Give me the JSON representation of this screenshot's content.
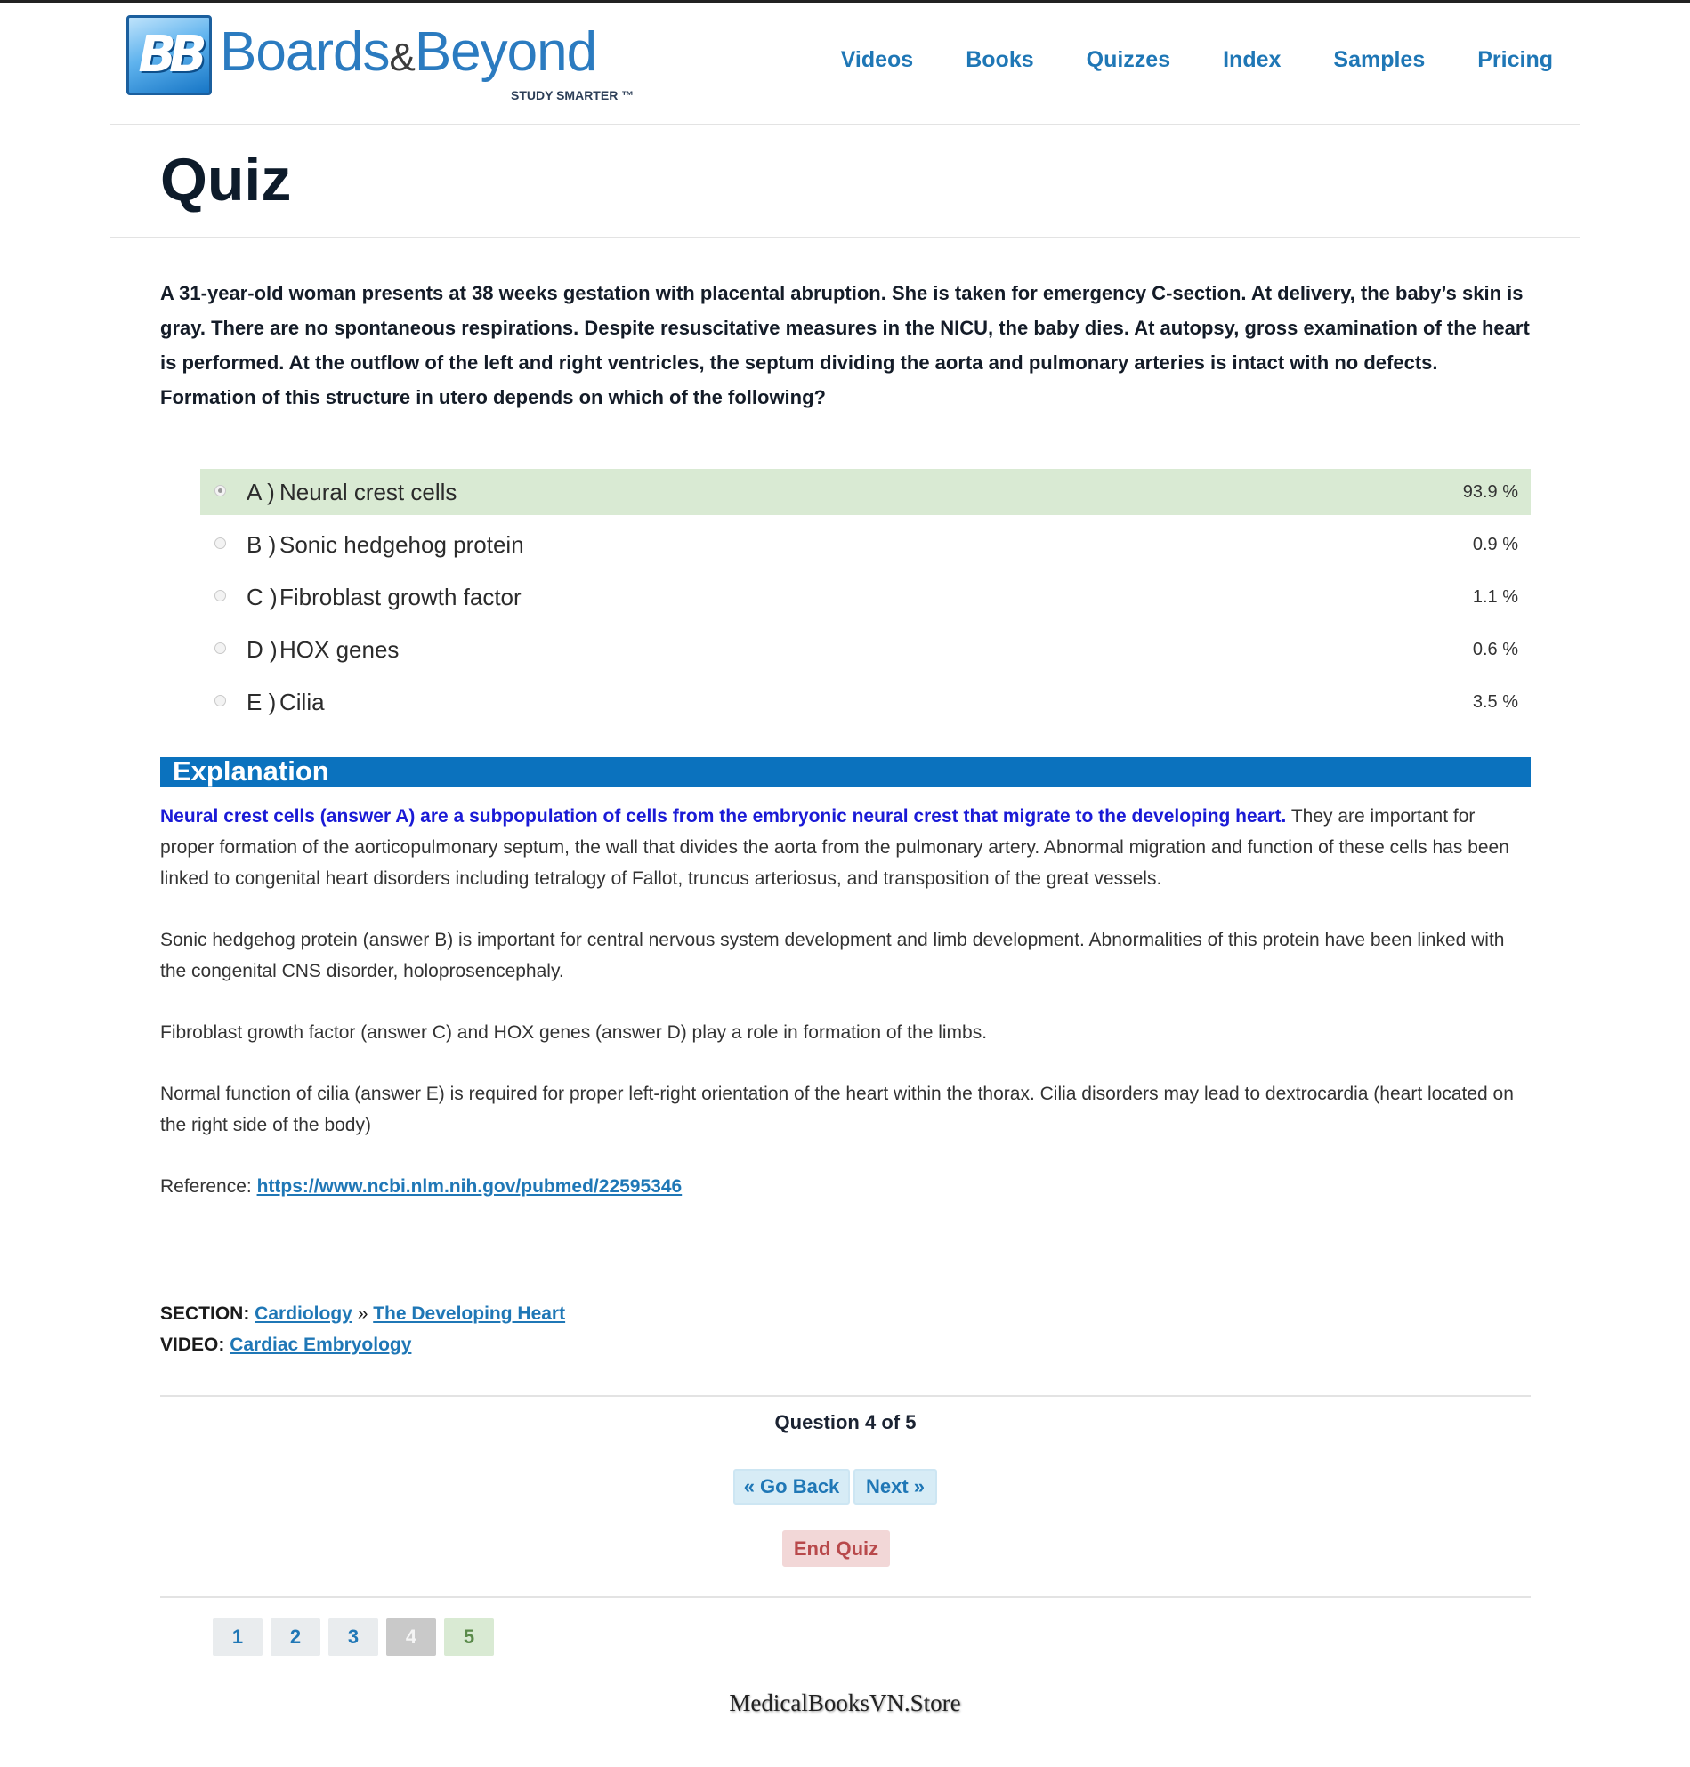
{
  "brand": {
    "badge": "BB",
    "word_left": "Boards",
    "amp": "&",
    "word_right": "Beyond",
    "tagline": "STUDY SMARTER ™"
  },
  "nav": [
    "Videos",
    "Books",
    "Quizzes",
    "Index",
    "Samples",
    "Pricing"
  ],
  "page_title": "Quiz",
  "question": "A 31-year-old woman presents at 38 weeks gestation with placental abruption. She is taken for emergency C-section. At delivery, the baby’s skin is gray. There are no spontaneous respirations. Despite resuscitative measures in the NICU, the baby dies. At autopsy, gross examination of the heart is performed. At the outflow of the left and right ventricles, the septum dividing the aorta and pulmonary arteries is intact with no defects. Formation of this structure in utero depends on which of the following?",
  "answers": [
    {
      "letter": "A )",
      "text": "Neural crest cells",
      "pct": "93.9 %",
      "selected": true
    },
    {
      "letter": "B )",
      "text": "Sonic hedgehog protein",
      "pct": "0.9 %",
      "selected": false
    },
    {
      "letter": "C )",
      "text": "Fibroblast growth factor",
      "pct": "1.1 %",
      "selected": false
    },
    {
      "letter": "D )",
      "text": "HOX genes",
      "pct": "0.6 %",
      "selected": false
    },
    {
      "letter": "E )",
      "text": "Cilia",
      "pct": "3.5 %",
      "selected": false
    }
  ],
  "explanation": {
    "heading": "Explanation",
    "p1_highlight": "Neural crest cells (answer A) are a subpopulation of cells from the embryonic neural crest that migrate to the developing heart.",
    "p1_rest": " They are important for proper formation of the aorticopulmonary septum, the wall that divides the aorta from the pulmonary artery. Abnormal migration and function of these cells has been linked to congenital heart disorders including tetralogy of Fallot, truncus arteriosus, and transposition of the great vessels.",
    "p2": "Sonic hedgehog protein (answer B) is important for central nervous system development and limb development. Abnormalities of this protein have been linked with the congenital CNS disorder, holoprosencephaly.",
    "p3": "Fibroblast growth factor (answer C) and HOX genes (answer D) play a role in formation of the limbs.",
    "p4": "Normal function of cilia (answer E) is required for proper left-right orientation of the heart within the thorax. Cilia disorders may lead to dextrocardia (heart located on the right side of the body)",
    "reference_label": "Reference: ",
    "reference_url": "https://www.ncbi.nlm.nih.gov/pubmed/22595346"
  },
  "meta": {
    "section_label": "SECTION: ",
    "section_link1": "Cardiology",
    "section_sep": " » ",
    "section_link2": "The Developing Heart",
    "video_label": "VIDEO: ",
    "video_link": "Cardiac Embryology"
  },
  "progress": "Question 4 of 5",
  "buttons": {
    "back": "« Go Back",
    "next": "Next »",
    "end": "End Quiz"
  },
  "pager": [
    {
      "label": "1",
      "state": "normal"
    },
    {
      "label": "2",
      "state": "normal"
    },
    {
      "label": "3",
      "state": "normal"
    },
    {
      "label": "4",
      "state": "current"
    },
    {
      "label": "5",
      "state": "answered"
    }
  ],
  "watermark": "MedicalBooksVN.Store",
  "colors": {
    "link": "#1f77b6",
    "explanation_bar": "#0b72be",
    "selected_answer": "#d9ead3",
    "end_quiz": "#b8494b"
  }
}
